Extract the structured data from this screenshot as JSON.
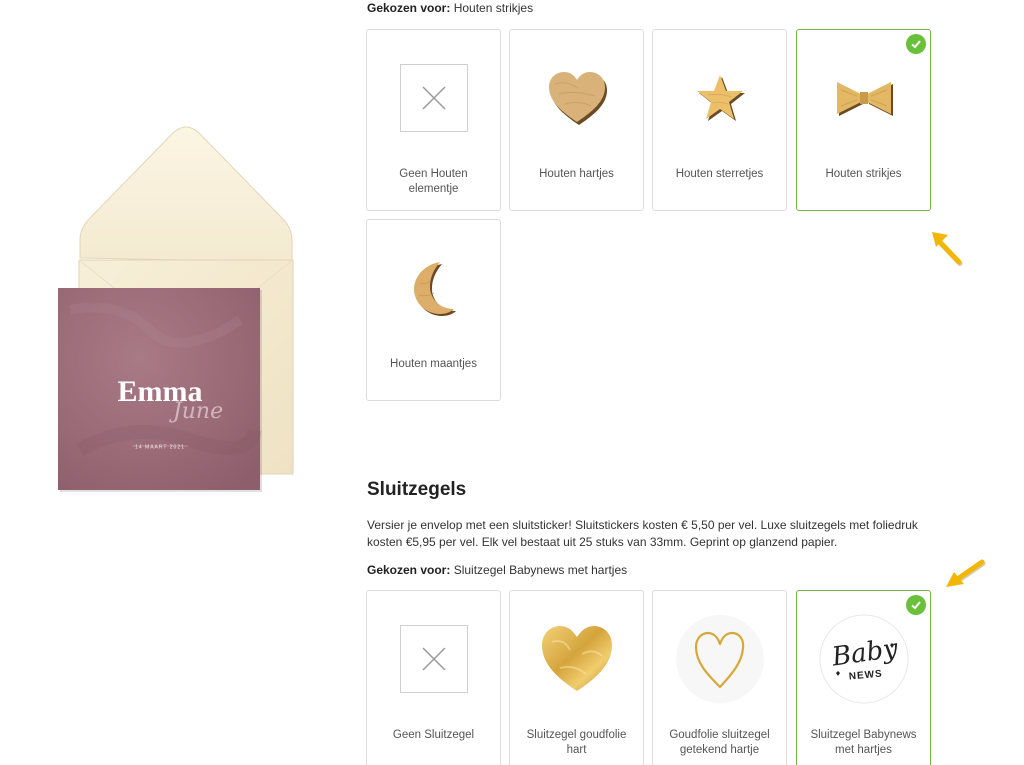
{
  "preview": {
    "name_first": "Emma",
    "name_script": "June",
    "date_text": "14 MAART 2021"
  },
  "wood_section": {
    "chosen_prefix": "Gekozen voor:",
    "chosen_value": "Houten strikjes",
    "options": [
      {
        "label": "Geen Houten elementje",
        "icon": "none-x-icon",
        "selected": false
      },
      {
        "label": "Houten hartjes",
        "icon": "wooden-heart-icon",
        "selected": false
      },
      {
        "label": "Houten sterretjes",
        "icon": "wooden-star-icon",
        "selected": false
      },
      {
        "label": "Houten strikjes",
        "icon": "wooden-bow-icon",
        "selected": true
      },
      {
        "label": "Houten maantjes",
        "icon": "wooden-moon-icon",
        "selected": false
      }
    ]
  },
  "seal_section": {
    "title": "Sluitzegels",
    "description": "Versier je envelop met een sluitsticker! Sluitstickers kosten € 5,50 per vel. Luxe sluitzegels met foliedruk kosten €5,95 per vel. Elk vel bestaat uit 25 stuks van 33mm. Geprint op glanzend papier.",
    "chosen_prefix": "Gekozen voor:",
    "chosen_value": "Sluitzegel Babynews met hartjes",
    "options": [
      {
        "label": "Geen Sluitzegel",
        "icon": "none-x-icon",
        "selected": false
      },
      {
        "label": "Sluitzegel goudfolie hart",
        "icon": "gold-foil-heart-icon",
        "selected": false
      },
      {
        "label": "Goudfolie sluitzegel getekend hartje",
        "icon": "gold-outline-heart-icon",
        "selected": false
      },
      {
        "label": "Sluitzegel Babynews met hartjes",
        "icon": "babynews-seal-icon",
        "selected": true
      }
    ],
    "seal_text_line1": "Baby",
    "seal_text_line2": "NEWS"
  },
  "colors": {
    "selected_border": "#7cb342",
    "check_badge": "#6abf3b",
    "arrow": "#f2b705",
    "card": "#9a6b78",
    "envelope": "#f8f0dc"
  }
}
